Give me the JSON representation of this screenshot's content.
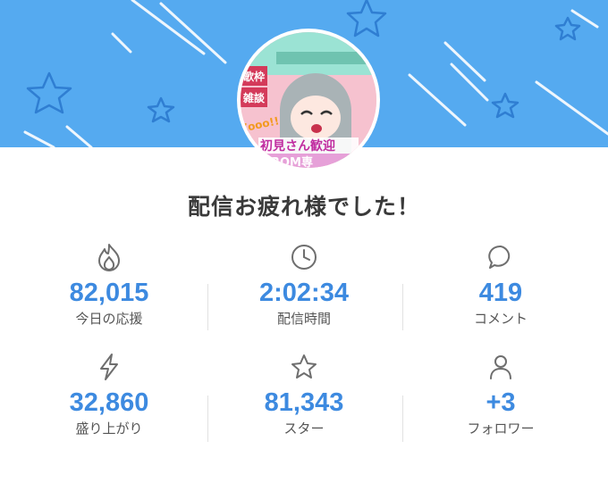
{
  "headline": "配信お疲れ様でした！",
  "avatar": {
    "tags": [
      "歌枠",
      "雑談"
    ],
    "texts": [
      "Zooo!!",
      "初見さん歓迎",
      "ROM専"
    ]
  },
  "stats": [
    {
      "icon": "flame-icon",
      "value": "82,015",
      "label": "今日の応援"
    },
    {
      "icon": "clock-icon",
      "value": "2:02:34",
      "label": "配信時間"
    },
    {
      "icon": "comment-bubble-icon",
      "value": "419",
      "label": "コメント"
    },
    {
      "icon": "lightning-icon",
      "value": "32,860",
      "label": "盛り上がり"
    },
    {
      "icon": "star-outline-icon",
      "value": "81,343",
      "label": "スター"
    },
    {
      "icon": "person-icon",
      "value": "+3",
      "label": "フォロワー"
    }
  ],
  "colors": {
    "banner": "#55aaf0",
    "value": "#3d8ae0",
    "icon": "#6e6e6e"
  }
}
